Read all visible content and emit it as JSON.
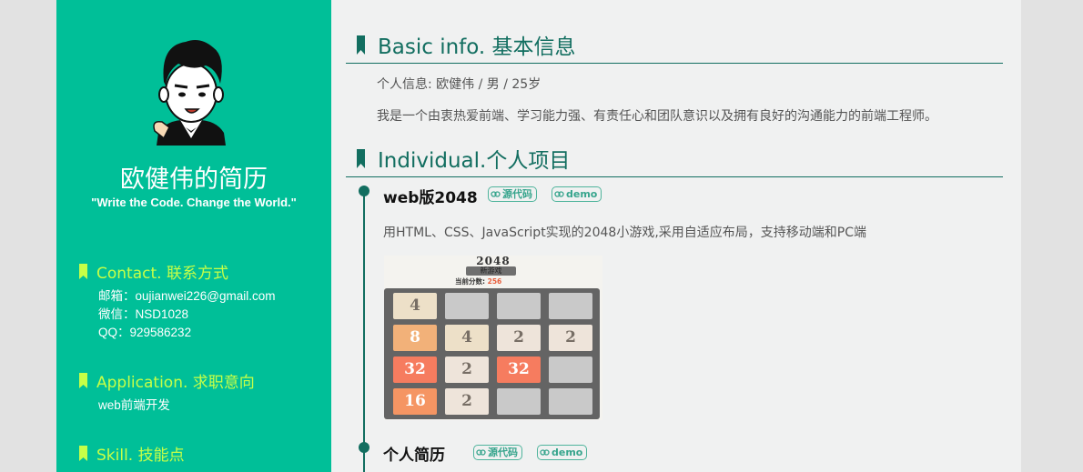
{
  "sidebar": {
    "name": "欧健伟的简历",
    "motto": "\"Write the Code. Change the World.\"",
    "sections": [
      {
        "title": "Contact. 联系方式",
        "lines": [
          "邮箱：oujianwei226@gmail.com",
          "微信：NSD1028",
          "QQ：929586232"
        ]
      },
      {
        "title": "Application. 求职意向",
        "lines": [
          "web前端开发"
        ]
      },
      {
        "title": "Skill. 技能点",
        "lines": []
      }
    ]
  },
  "basic": {
    "title": "Basic info. 基本信息",
    "personal": "个人信息: 欧健伟 / 男 / 25岁",
    "summary": "我是一个由衷热爱前端、学习能力强、有责任心和团队意识以及拥有良好的沟通能力的前端工程师。"
  },
  "individual": {
    "title": "Individual.个人项目",
    "projects": [
      {
        "title": "web版2048",
        "source_label": "源代码",
        "demo_label": "demo",
        "description": "用HTML、CSS、JavaScript实现的2048小游戏,采用自适应布局，支持移动端和PC端",
        "screenshot": {
          "title": "2048",
          "new_game": "新游戏",
          "score_label": "当前分数:",
          "score": "256",
          "grid": [
            [
              "4",
              "",
              "",
              ""
            ],
            [
              "8",
              "4",
              "2",
              "2"
            ],
            [
              "32",
              "2",
              "32",
              ""
            ],
            [
              "16",
              "2",
              "",
              ""
            ]
          ]
        }
      },
      {
        "title": "个人简历",
        "source_label": "源代码",
        "demo_label": "demo"
      }
    ]
  },
  "colors": {
    "sidebar_bg": "#00bf98",
    "accent_lime": "#c6ff47",
    "main_bg": "#f0f1f1",
    "heading_green": "#126e60"
  }
}
